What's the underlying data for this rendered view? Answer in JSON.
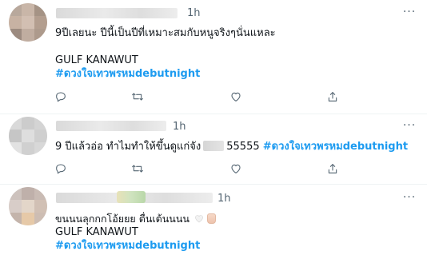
{
  "tweets": [
    {
      "time": "1h",
      "line1": "9ปีเลยนะ ปีนี้เป็นปีที่เหมาะสมกับหนูจริงๆนั่นแหละ",
      "line2": "GULF KANAWUT",
      "hashtag": "#ดวงใจเทวพรหมdebutnight",
      "more_icon": "more-dots-icon"
    },
    {
      "time": "1h",
      "text_before": "9 ปีแล้วอ่อ ทำไมทำให้ขึ้นดูแก่จัง",
      "text_after": "55555",
      "hashtag": "#ดวงใจเทวพรหมdebutnight",
      "more_icon": "more-dots-icon"
    },
    {
      "time": "1h",
      "line1": "ขนนนลุกกกโอ้ยยย ตื่นเต้นนนน",
      "line2": "GULF KANAWUT",
      "hashtag": "#ดวงใจเทวพรหมdebutnight",
      "more_icon": "more-dots-icon"
    }
  ],
  "icons": [
    "reply-icon",
    "retweet-icon",
    "like-icon",
    "share-icon"
  ],
  "colors": {
    "hashtag": "#1d9bf0",
    "muted": "#536471",
    "text": "#0f1419",
    "divider": "#eff3f4"
  }
}
